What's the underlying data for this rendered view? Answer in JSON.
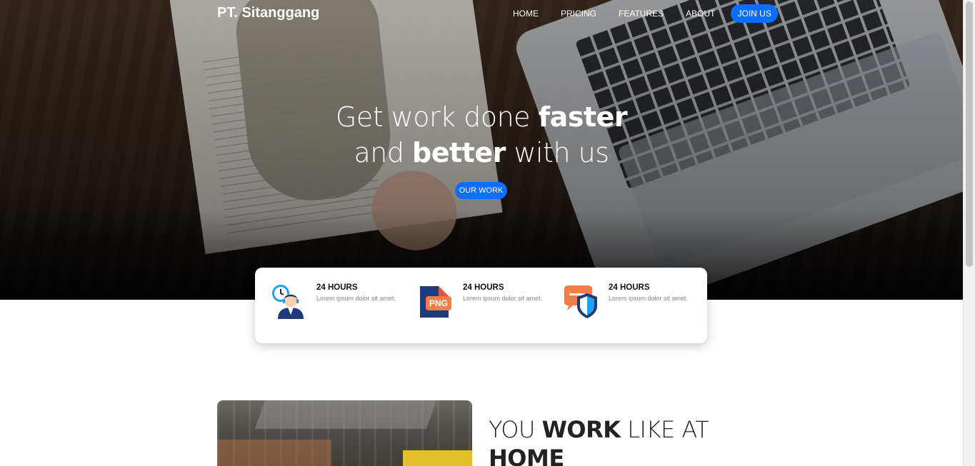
{
  "nav": {
    "brand": "PT. Sitanggang",
    "links": [
      "HOME",
      "PRICING",
      "FEATURES",
      "ABOUT"
    ],
    "cta": "JOIN US"
  },
  "hero": {
    "line1_regular": "Get work done ",
    "line1_bold": "faster",
    "line2_regular_a": "and ",
    "line2_bold": "better",
    "line2_regular_b": " with us",
    "button": "OUR WORK"
  },
  "features": [
    {
      "icon": "clock-agent-icon",
      "title": "24 HOURS",
      "desc": "Lorem ipsum dolor sit amet."
    },
    {
      "icon": "png-file-icon",
      "title": "24 HOURS",
      "desc": "Lorem ipsum dolor sit amet.",
      "badge": "PNG"
    },
    {
      "icon": "chat-shield-icon",
      "title": "24 HOURS",
      "desc": "Lorem ipsum dolor sit amet."
    }
  ],
  "about": {
    "title_a": "YOU ",
    "title_bold": "WORK",
    "title_b": " LIKE AT",
    "title_line2": "HOME"
  },
  "colors": {
    "primary": "#0d6efd",
    "card_bg": "#ffffff",
    "text_dark": "#222222"
  }
}
